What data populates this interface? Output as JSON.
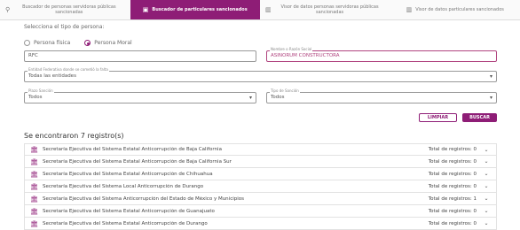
{
  "tabs": [
    {
      "label": "Buscador de personas servidoras públicas sancionadas",
      "icon": "people-search-icon",
      "active": false
    },
    {
      "label": "Buscador de particulares sancionados",
      "icon": "briefcase-icon",
      "active": true
    },
    {
      "label": "Visor de datos personas servidoras públicas sancionadas",
      "icon": "bar-chart-icon",
      "active": false
    },
    {
      "label": "Visor de datos particulares sancionados",
      "icon": "bar-chart-icon",
      "active": false
    }
  ],
  "form": {
    "prompt": "Selecciona el tipo de persona:",
    "radio_fisica": "Persona física",
    "radio_moral": "Persona Moral",
    "rfc_value": "RFC",
    "razon_label": "Nombre o Razón Social",
    "razon_value": "ASINORUM CONSTRUCTORA",
    "entidad_label": "Entidad Federativa donde se cometió la falta",
    "entidad_value": "Todas las entidades",
    "periodo_label": "Plazo Sanción",
    "periodo_value": "Todos",
    "tipo_label": "Tipo de Sanción",
    "tipo_value": "Todos",
    "clear_label": "LIMPIAR",
    "search_label": "BUSCAR"
  },
  "results": {
    "count_text": "Se encontraron 7 registro(s)",
    "rows": [
      {
        "name": "Secretaría Ejecutiva del Sistema Estatal Anticorrupción de Baja California",
        "total": "Total de registros: 0"
      },
      {
        "name": "Secretaría Ejecutiva del Sistema Estatal Anticorrupción de Baja California Sur",
        "total": "Total de registros: 0"
      },
      {
        "name": "Secretaría Ejecutiva del Sistema Estatal Anticorrupción de Chihuahua",
        "total": "Total de registros: 0"
      },
      {
        "name": "Secretaría Ejecutiva del Sistema Local Anticorrupción de Durango",
        "total": "Total de registros: 0"
      },
      {
        "name": "Secretaría Ejecutiva del Sistema Anticorrupción del Estado de México y Municipios",
        "total": "Total de registros: 1"
      },
      {
        "name": "Secretaría Ejecutiva del Sistema Estatal Anticorrupción de Guanajuato",
        "total": "Total de registros: 0"
      },
      {
        "name": "Secretaría Ejecutiva del Sistema Estatal Anticorrupción de Durango",
        "total": "Total de registros: 0"
      }
    ]
  },
  "colors": {
    "accent": "#8e1d76",
    "focus": "#b0447f"
  }
}
